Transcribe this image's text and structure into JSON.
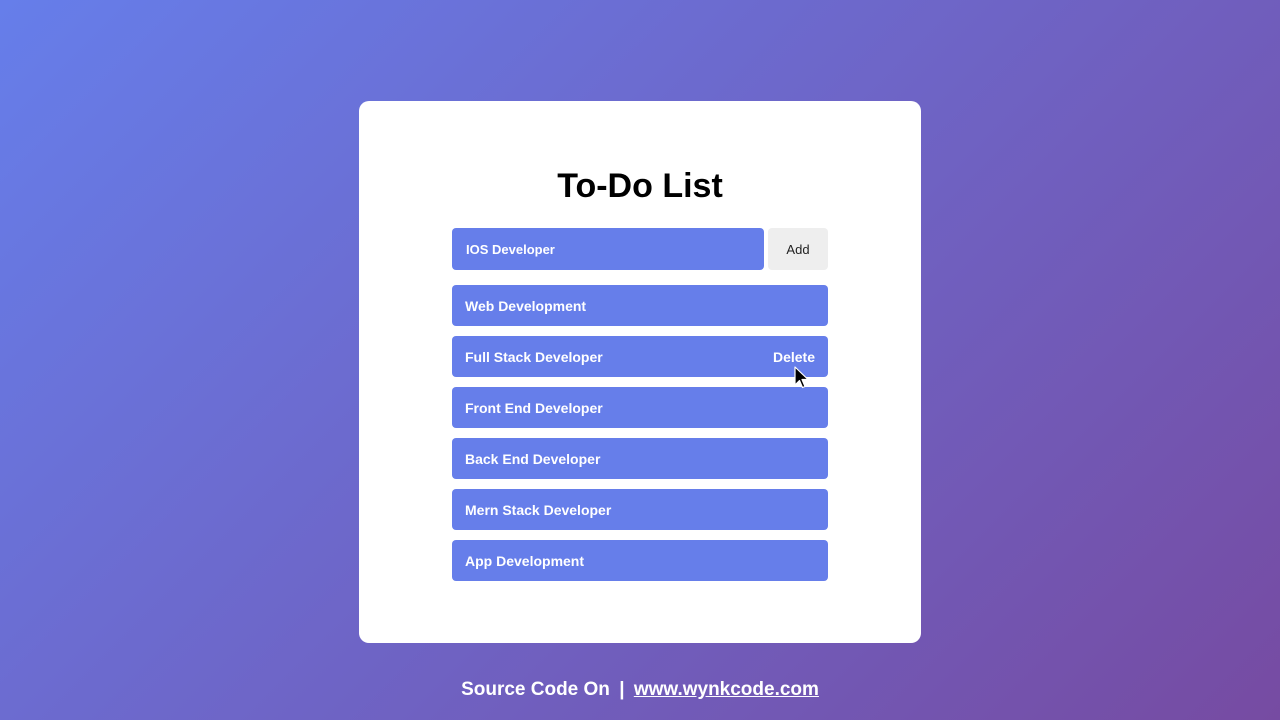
{
  "card": {
    "title": "To-Do List",
    "input": {
      "value": "IOS Developer"
    },
    "add_label": "Add",
    "delete_label": "Delete",
    "items": [
      {
        "label": "Web Development"
      },
      {
        "label": "Full Stack Developer"
      },
      {
        "label": "Front End Developer"
      },
      {
        "label": "Back End Developer"
      },
      {
        "label": "Mern Stack Developer"
      },
      {
        "label": "App Development"
      }
    ]
  },
  "footer": {
    "prefix": "Source Code On",
    "separator": "|",
    "link": "www.wynkcode.com"
  },
  "colors": {
    "accent": "#667eea",
    "gradient_start": "#667eea",
    "gradient_end": "#764ba2"
  },
  "icons": {
    "cursor": "mouse-pointer-icon"
  }
}
